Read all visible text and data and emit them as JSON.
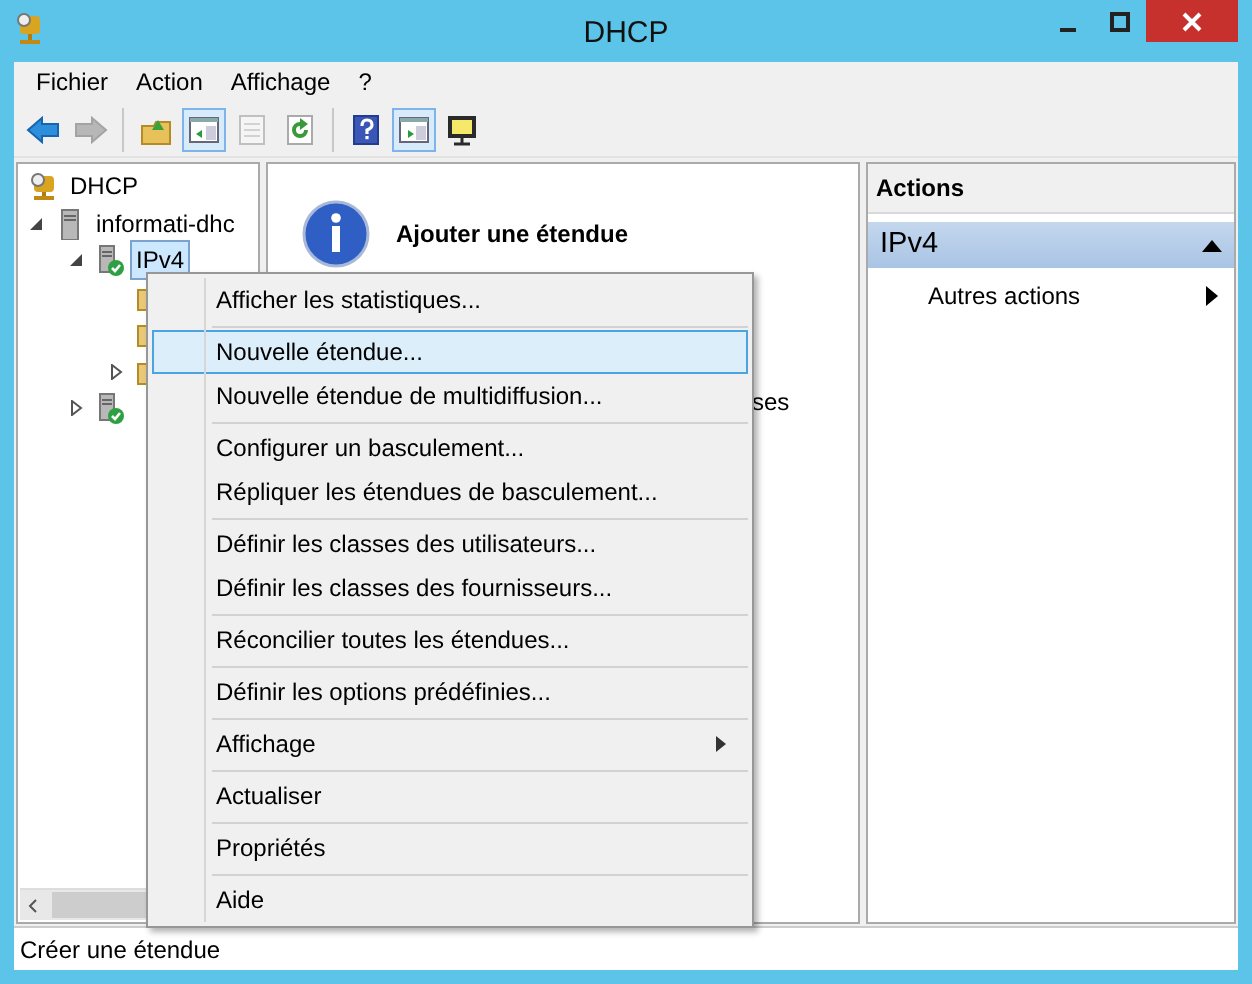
{
  "window": {
    "title": "DHCP"
  },
  "menu_bar": [
    "Fichier",
    "Action",
    "Affichage",
    "?"
  ],
  "toolbar": [
    {
      "kind": "back",
      "disabled": false,
      "pressed": false
    },
    {
      "kind": "forward",
      "disabled": true,
      "pressed": false
    },
    {
      "kind": "separator"
    },
    {
      "kind": "up-folder",
      "disabled": false,
      "pressed": false
    },
    {
      "kind": "tree-toggle",
      "disabled": false,
      "pressed": true
    },
    {
      "kind": "properties",
      "disabled": true,
      "pressed": false
    },
    {
      "kind": "refresh",
      "disabled": false,
      "pressed": false
    },
    {
      "kind": "separator"
    },
    {
      "kind": "help",
      "disabled": false,
      "pressed": false
    },
    {
      "kind": "action-toggle",
      "disabled": false,
      "pressed": true
    },
    {
      "kind": "monitor",
      "disabled": false,
      "pressed": false
    }
  ],
  "tree": [
    {
      "kind": "root",
      "label": "DHCP",
      "selected": false,
      "children": [
        {
          "kind": "server",
          "label": "informati-dhc",
          "selected": false,
          "expanded": true,
          "children": [
            {
              "kind": "scope-server",
              "label": "IPv4",
              "selected": true,
              "expanded": true,
              "children": [
                {
                  "kind": "folder",
                  "selected": false
                },
                {
                  "kind": "folder",
                  "selected": false
                },
                {
                  "kind": "folder",
                  "selected": false,
                  "expanded": false
                }
              ]
            },
            {
              "kind": "scope-server",
              "selected": false,
              "expanded": false
            }
          ]
        }
      ]
    }
  ],
  "info_panel": {
    "title": "Ajouter une étendue",
    "text_fragment": "ses"
  },
  "actions_pane": {
    "header": "Actions",
    "section": {
      "title": "IPv4",
      "expanded": true
    },
    "items": [
      {
        "label": "Autres actions",
        "submenu": true
      }
    ]
  },
  "context_menu": [
    [
      {
        "label": "Afficher les statistiques...",
        "selected": false,
        "submenu": false
      }
    ],
    [
      {
        "label": "Nouvelle étendue...",
        "selected": true,
        "submenu": false
      },
      {
        "label": "Nouvelle étendue de multidiffusion...",
        "selected": false,
        "submenu": false
      }
    ],
    [
      {
        "label": "Configurer un basculement...",
        "selected": false,
        "submenu": false
      },
      {
        "label": "Répliquer les étendues de basculement...",
        "selected": false,
        "submenu": false
      }
    ],
    [
      {
        "label": "Définir les classes des utilisateurs...",
        "selected": false,
        "submenu": false
      },
      {
        "label": "Définir les classes des fournisseurs...",
        "selected": false,
        "submenu": false
      }
    ],
    [
      {
        "label": "Réconcilier toutes les étendues...",
        "selected": false,
        "submenu": false
      }
    ],
    [
      {
        "label": "Définir les options prédéfinies...",
        "selected": false,
        "submenu": false
      }
    ],
    [
      {
        "label": "Affichage",
        "selected": false,
        "submenu": true
      }
    ],
    [
      {
        "label": "Actualiser",
        "selected": false,
        "submenu": false
      }
    ],
    [
      {
        "label": "Propriétés",
        "selected": false,
        "submenu": false
      }
    ],
    [
      {
        "label": "Aide",
        "selected": false,
        "submenu": false
      }
    ]
  ],
  "status_bar": "Créer une étendue"
}
